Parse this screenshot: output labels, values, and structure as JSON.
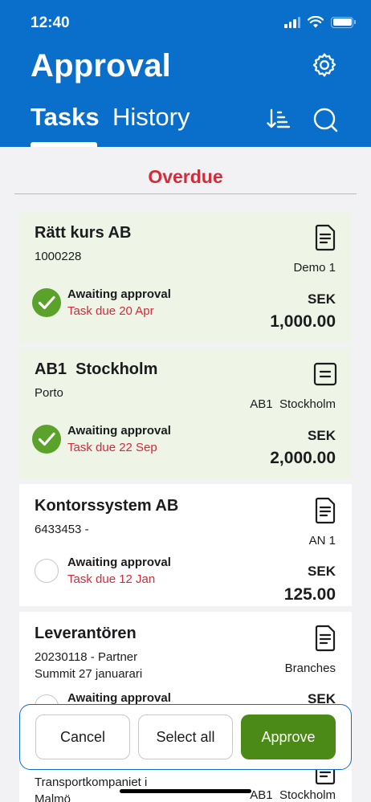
{
  "status_bar": {
    "time": "12:40"
  },
  "header": {
    "title": "Approval",
    "tabs": [
      {
        "label": "Tasks",
        "active": true
      },
      {
        "label": "History",
        "active": false
      }
    ],
    "icons": {
      "settings": "gear-icon",
      "sort": "sort-icon",
      "search": "search-icon"
    }
  },
  "section": {
    "label": "Overdue"
  },
  "tasks": [
    {
      "name": "Rätt kurs AB",
      "sub": "1000228",
      "right": "Demo 1",
      "status": "Awaiting approval",
      "due": "Task due 20 Apr",
      "currency": "SEK",
      "amount": "1,000.00",
      "selected": true,
      "icon": "document-list-icon"
    },
    {
      "name": "AB1  Stockholm",
      "sub": "Porto",
      "right": "AB1  Stockholm",
      "status": "Awaiting approval",
      "due": "Task due 22 Sep",
      "currency": "SEK",
      "amount": "2,000.00",
      "selected": true,
      "icon": "invoice-icon"
    },
    {
      "name": "Kontorssystem AB",
      "sub": "6433453 -",
      "right": "AN 1",
      "status": "Awaiting approval",
      "due": "Task due 12 Jan",
      "currency": "SEK",
      "amount": "125.00",
      "selected": false,
      "icon": "document-list-icon"
    },
    {
      "name": "Leverantören",
      "sub_line1": "20230118 - Partner",
      "sub_line2": "Summit 27 januarari",
      "right": "Branches",
      "status": "Awaiting approval",
      "currency": "SEK",
      "selected": false,
      "icon": "document-list-icon"
    },
    {
      "sub_line1": "Transportkompaniet i",
      "sub_line2": "Malmö",
      "right": "AB1  Stockholm"
    }
  ],
  "actions": {
    "cancel": "Cancel",
    "select_all": "Select all",
    "approve": "Approve"
  },
  "colors": {
    "header_blue": "#0a6fcb",
    "overdue_red": "#d22b3a",
    "approve_green": "#4b8a17",
    "check_green": "#5aa22a",
    "selected_card_bg": "#eef4e6"
  }
}
